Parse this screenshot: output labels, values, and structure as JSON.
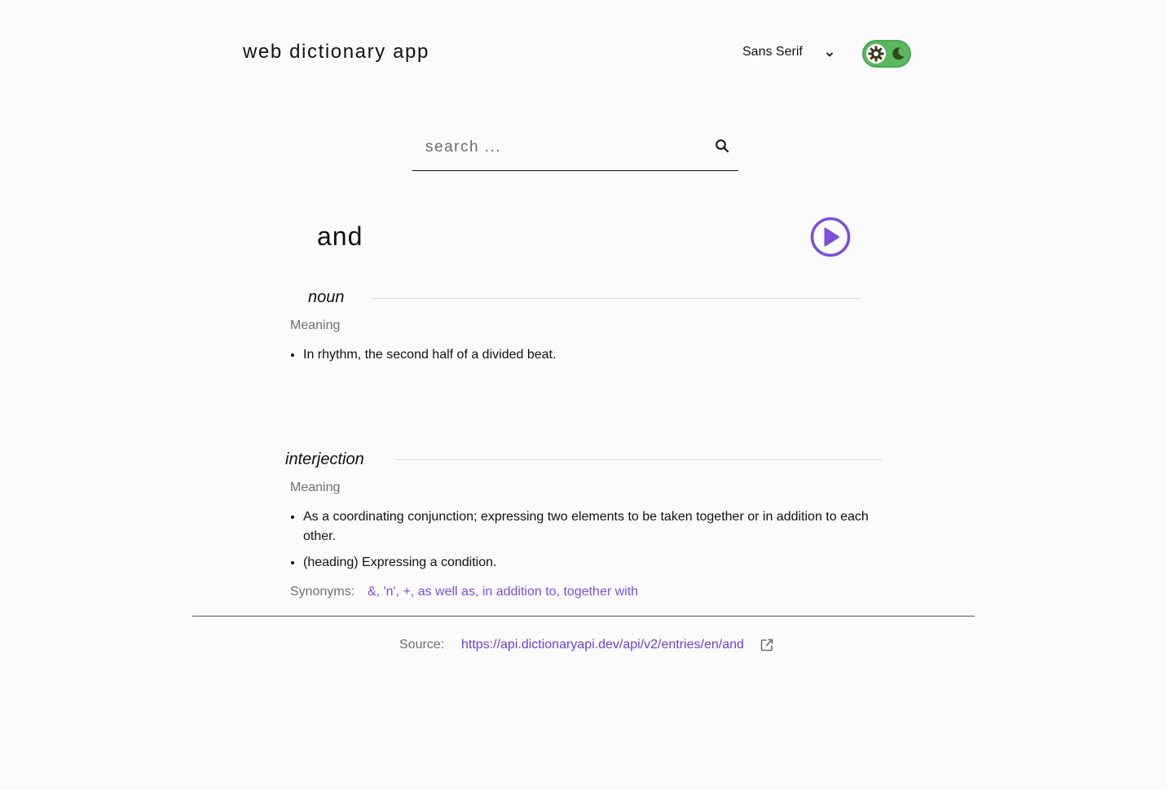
{
  "header": {
    "app_title": "web dictionary app",
    "font_select_value": "Sans Serif",
    "theme_toggle_colors": {
      "track": "#5bb85f",
      "icon": "#3a3a1a"
    }
  },
  "search": {
    "placeholder": "search ..."
  },
  "entry": {
    "word": "and",
    "play_color": "#7b4fd9",
    "meanings": [
      {
        "part_of_speech": "noun",
        "meaning_label": "Meaning",
        "definitions": [
          "In rhythm, the second half of a divided beat."
        ]
      },
      {
        "part_of_speech": "interjection",
        "meaning_label": "Meaning",
        "definitions": [
          "As a coordinating conjunction; expressing two elements to be taken together or in addition to each other.",
          "(heading) Expressing a condition."
        ],
        "synonyms_label": "Synonyms:",
        "synonyms": "&, 'n', +, as well as, in addition to, together with"
      }
    ]
  },
  "footer": {
    "source_label": "Source:",
    "source_url": "https://api.dictionaryapi.dev/api/v2/entries/en/and"
  },
  "colors": {
    "accent": "#7b4fd9",
    "link": "#6a42d6",
    "muted": "#6f6f6f",
    "background": "#fbfbfb"
  }
}
